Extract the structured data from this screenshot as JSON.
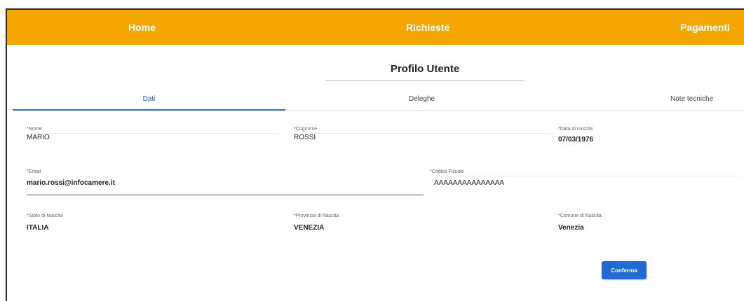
{
  "nav": {
    "home": "Home",
    "richieste": "Richieste",
    "pagamenti": "Pagamenti"
  },
  "page": {
    "title": "Profilo Utente"
  },
  "tabs": {
    "dati": "Dati",
    "deleghe": "Deleghe",
    "note": "Note tecniche"
  },
  "form": {
    "nome": {
      "label": "*Nome",
      "value": "MARIO"
    },
    "cognome": {
      "label": "*Cognome",
      "value": "ROSSI"
    },
    "data_nascita": {
      "label": "*Data di nascita",
      "value": "07/03/1976"
    },
    "email": {
      "label": "*Email",
      "value": "mario.rossi@infocamere.it"
    },
    "codice_fiscale": {
      "label": "*Codice Fiscale",
      "value": "AAAAAAAAAAAAAAA"
    },
    "stato_nascita": {
      "label": "*Stato di Nascita",
      "value": "ITALIA"
    },
    "provincia_nascita": {
      "label": "*Provincia di Nascita",
      "value": "VENEZIA"
    },
    "comune_nascita": {
      "label": "*Comune di Nascita",
      "value": "Venezia"
    }
  },
  "actions": {
    "conferma": "Conferma"
  },
  "colors": {
    "header": "#f5a600",
    "accent": "#1f6ad3"
  }
}
